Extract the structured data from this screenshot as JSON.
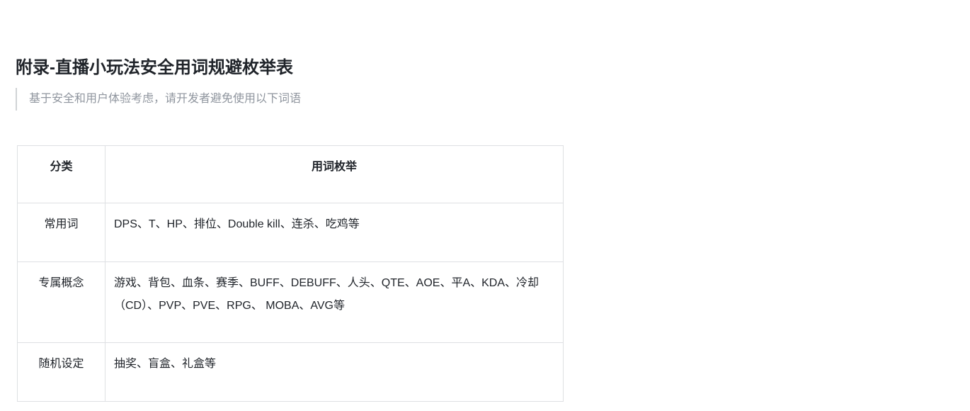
{
  "document": {
    "title": "附录-直播小玩法安全用词规避枚举表",
    "quote": "基于安全和用户体验考虑，请开发者避免使用以下词语"
  },
  "table": {
    "headers": [
      "分类",
      "用词枚举"
    ],
    "rows": [
      {
        "category": "常用词",
        "words": "DPS、T、HP、排位、Double kill、连杀、吃鸡等"
      },
      {
        "category": "专属概念",
        "words": "游戏、背包、血条、赛季、BUFF、DEBUFF、人头、QTE、AOE、平A、KDA、冷却（CD）、PVP、PVE、RPG、 MOBA、AVG等"
      },
      {
        "category": "随机设定",
        "words": "抽奖、盲盒、礼盒等"
      }
    ]
  }
}
